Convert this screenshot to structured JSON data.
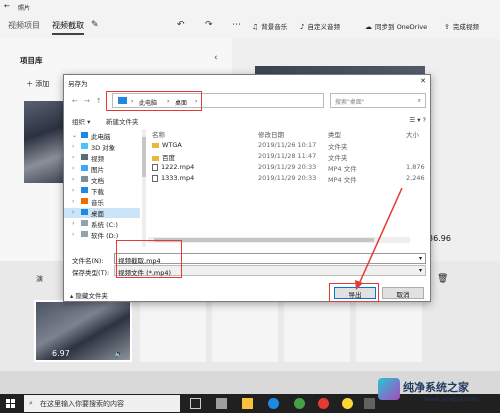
{
  "app": {
    "title": "照片",
    "tabs": [
      "视频项目",
      "视频截取"
    ],
    "toolbar": {
      "background_music": "背景音乐",
      "custom_audio": "自定义音频",
      "sync_onedrive": "同步到 OneDrive",
      "finish_video": "完成视频"
    }
  },
  "left_panel": {
    "heading": "项目库",
    "add_label": "添加"
  },
  "preview": {
    "time": "36.96"
  },
  "storyboard": {
    "label": "演",
    "clip_duration": "6.97"
  },
  "dialog": {
    "title": "另存为",
    "address": {
      "crumbs": [
        "此电脑",
        "桌面"
      ],
      "search_placeholder": "搜索\"桌面\""
    },
    "commands": {
      "organize": "组织 ▾",
      "new_folder": "新建文件夹"
    },
    "nav_tree": [
      {
        "label": "此电脑",
        "icon": "pc-icon",
        "color": "#1e88e5",
        "expanded": true
      },
      {
        "label": "3D 对象",
        "icon": "cube-icon",
        "color": "#4fc3f7"
      },
      {
        "label": "视频",
        "icon": "video-icon",
        "color": "#546e7a"
      },
      {
        "label": "图片",
        "icon": "picture-icon",
        "color": "#42a5f5"
      },
      {
        "label": "文档",
        "icon": "document-icon",
        "color": "#78909c"
      },
      {
        "label": "下载",
        "icon": "download-icon",
        "color": "#1e88e5"
      },
      {
        "label": "音乐",
        "icon": "music-icon",
        "color": "#ef6c00"
      },
      {
        "label": "桌面",
        "icon": "desktop-icon",
        "color": "#1e88e5",
        "selected": true
      },
      {
        "label": "系统 (C:)",
        "icon": "drive-icon",
        "color": "#90a4ae"
      },
      {
        "label": "软件 (D:)",
        "icon": "drive-icon",
        "color": "#90a4ae"
      }
    ],
    "columns": [
      "名称",
      "修改日期",
      "类型",
      "大小"
    ],
    "files": [
      {
        "name": "WTGA",
        "modified": "2019/11/26 10:17",
        "type": "文件夹",
        "size": "",
        "kind": "folder"
      },
      {
        "name": "百度",
        "modified": "2019/11/28 11:47",
        "type": "文件夹",
        "size": "",
        "kind": "folder"
      },
      {
        "name": "1222.mp4",
        "modified": "2019/11/29 20:33",
        "type": "MP4 文件",
        "size": "1,876",
        "kind": "mp4"
      },
      {
        "name": "1333.mp4",
        "modified": "2019/11/29 20:33",
        "type": "MP4 文件",
        "size": "2,246",
        "kind": "mp4"
      }
    ],
    "filename_label": "文件名(N):",
    "filename_value": "视频截取.mp4",
    "savetype_label": "保存类型(T):",
    "savetype_value": "视频文件 (*.mp4)",
    "hide_folders": "隐藏文件夹",
    "save_button": "导出",
    "cancel_button": "取消"
  },
  "taskbar": {
    "search_text": "在这里输入你要搜索的内容"
  },
  "watermark": {
    "title": "纯净系统之家",
    "url": "www.ycwjsy.com"
  },
  "colors": {
    "accent": "#0078d7",
    "highlight": "#e53935"
  }
}
